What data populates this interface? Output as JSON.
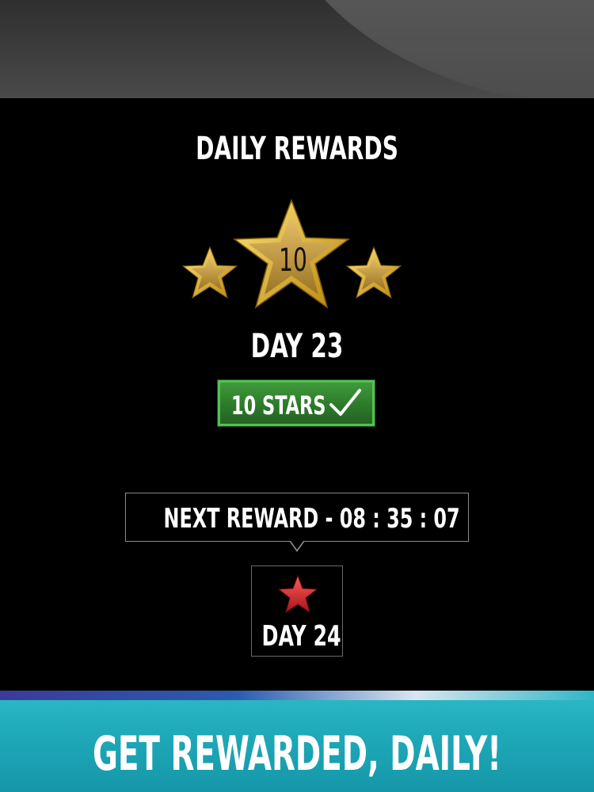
{
  "header": {
    "title": "DAILY REWARDS"
  },
  "current_reward": {
    "star_value": "10",
    "day_label": "DAY 23",
    "badge_label": "10 STARS",
    "claimed": true
  },
  "next_reward": {
    "countdown_label": "NEXT REWARD - 08 : 35 : 07",
    "day_label": "DAY 24"
  },
  "footer": {
    "tagline": "GET REWARDED, DAILY!"
  },
  "icons": {
    "gold_star": "star-icon",
    "check": "check-icon",
    "red_star": "star-icon"
  },
  "colors": {
    "background": "#000000",
    "gold": "#d9a91d",
    "badge_green": "#3f9a3b",
    "red_star": "#d0262a",
    "footer_teal": "#1ea8b8"
  }
}
